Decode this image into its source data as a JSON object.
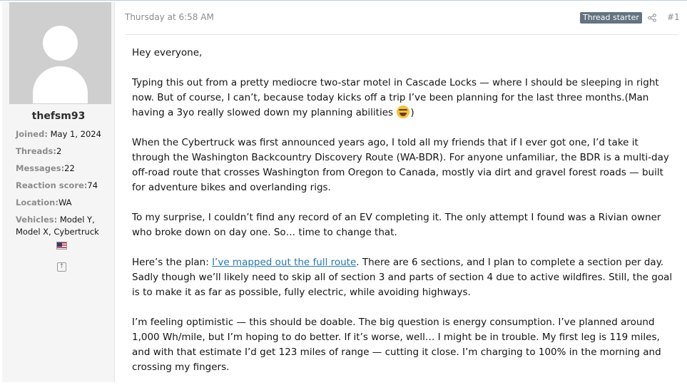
{
  "user": {
    "username": "thefsm93",
    "stats": [
      {
        "key": "Joined:",
        "value": "May 1, 2024"
      },
      {
        "key": "Threads:",
        "value": "2"
      },
      {
        "key": "Messages:",
        "value": "22"
      },
      {
        "key": "Reaction score:",
        "value": "74"
      },
      {
        "key": "Location:",
        "value": "WA"
      }
    ],
    "vehicles_key": "Vehicles:",
    "vehicles_value_line1": "Model Y,",
    "vehicles_value_line2": "Model X, Cybertruck",
    "flag_icon": "us-flag-icon",
    "jump_icon": "arrow-up-box-icon"
  },
  "message": {
    "timestamp": "Thursday at 6:58 AM",
    "badge": "Thread starter",
    "share_icon": "share-icon",
    "post_number": "#1",
    "p1": "Hey everyone,",
    "p2_text": "Typing this out from a pretty mediocre two-star motel in Cascade Locks — where I should be sleeping in right now. But of course, I can’t, because today kicks off a trip I’ve been planning for the last three months.(Man having a 3yo really slowed down my planning abilities",
    "p2_emoji": "laughing-emoji",
    "p2_end": ")",
    "p3": "When the Cybertruck was first announced years ago, I told all my friends that if I ever got one, I’d take it through the Washington Backcountry Discovery Route (WA-BDR). For anyone unfamiliar, the BDR is a multi-day off-road route that crosses Washington from Oregon to Canada, mostly via dirt and gravel forest roads — built for adventure bikes and overlanding rigs.",
    "p4": "To my surprise, I couldn’t find any record of an EV completing it. The only attempt I found was a Rivian owner who broke down on day one. So… time to change that.",
    "p5_before": "Here’s the plan: ",
    "p5_link": "I’ve mapped out the full route",
    "p5_after": ". There are 6 sections, and I plan to complete a section per day. Sadly though we’ll likely need to skip all of section 3 and parts of section 4 due to active wildfires. Still, the goal is to make it as far as possible, fully electric, while avoiding highways.",
    "p6": "I’m feeling optimistic — this should be doable. The big question is energy consumption. I’ve planned around 1,000 Wh/mile, but I’m hoping to do better. If it’s worse, well… I might be in trouble. My first leg is 119 miles, and with that estimate I’d get 123 miles of range — cutting it close. I’m charging to 100% in the morning and crossing my fingers."
  },
  "colors": {
    "link": "#2577b1",
    "badge_bg": "#647380",
    "muted": "#8c8c8c",
    "sidebar_bg": "#f5f5f5"
  }
}
